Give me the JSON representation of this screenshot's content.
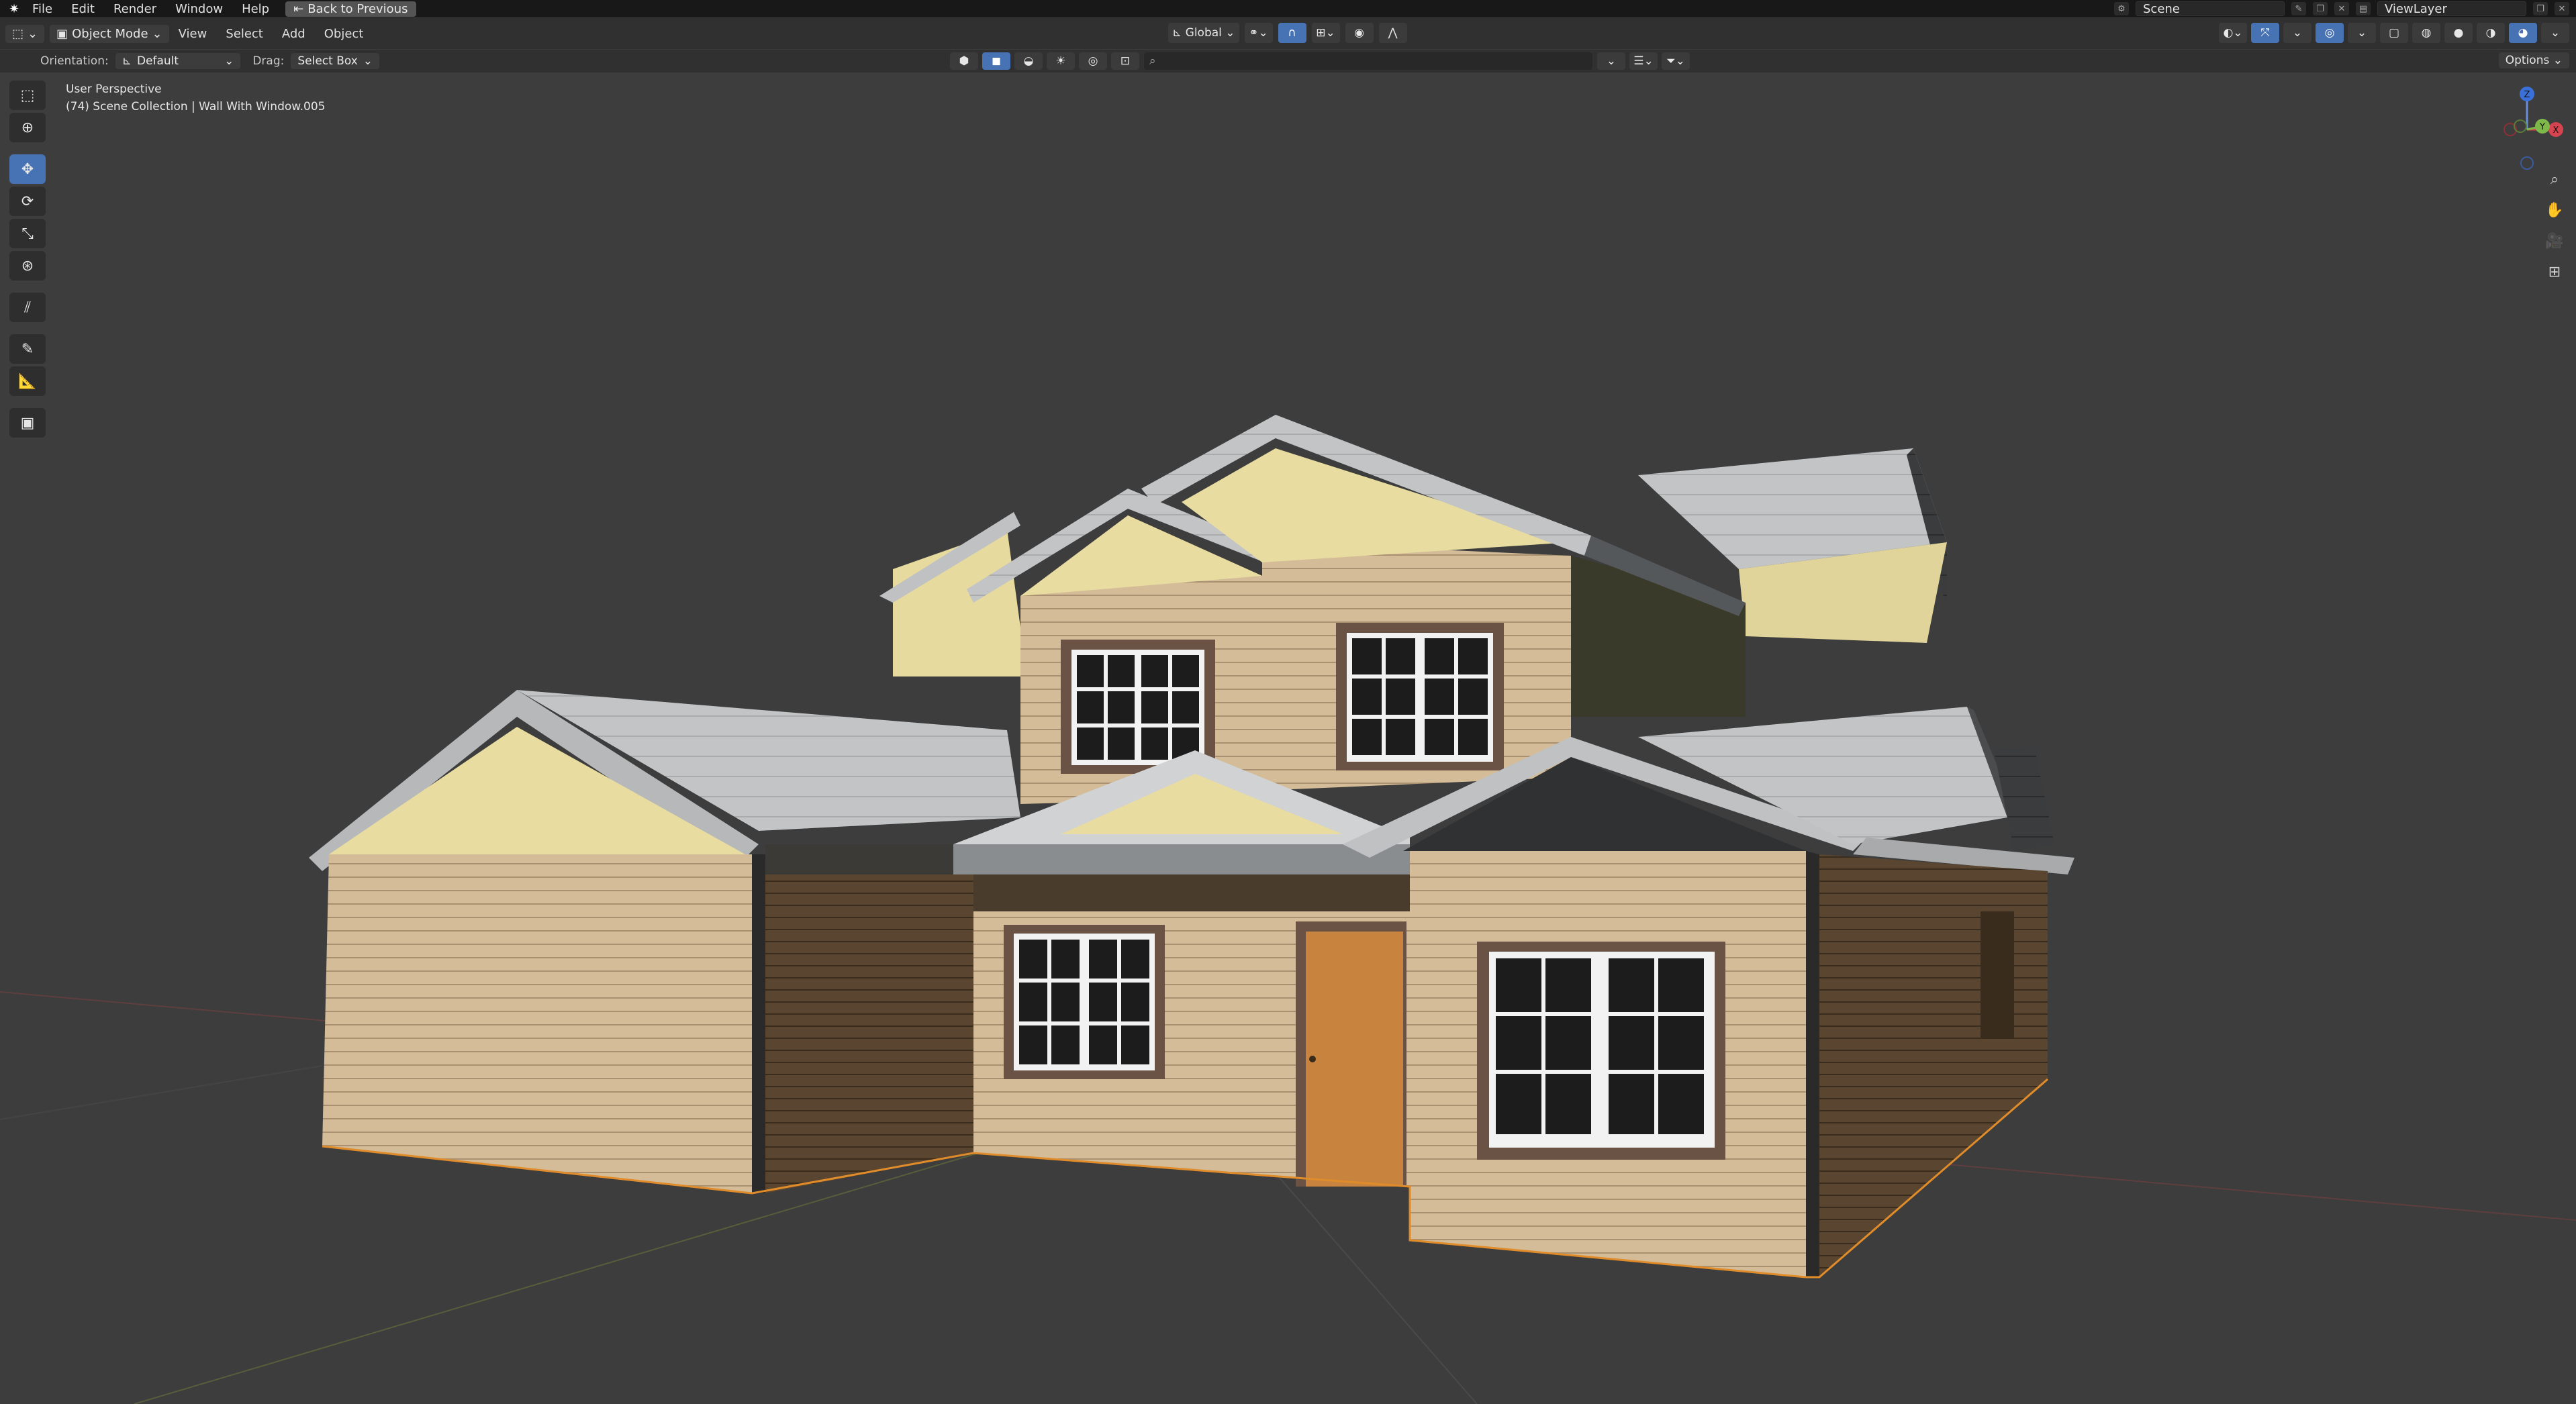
{
  "topbar": {
    "menus": [
      "File",
      "Edit",
      "Render",
      "Window",
      "Help"
    ],
    "back_button": "Back to Previous",
    "scene": "Scene",
    "view_layer": "ViewLayer"
  },
  "header": {
    "mode": "Object Mode",
    "menus": [
      "View",
      "Select",
      "Add",
      "Object"
    ],
    "transform_orientation": "Global"
  },
  "tool_settings": {
    "orientation_label": "Orientation:",
    "orientation_value": "Default",
    "drag_label": "Drag:",
    "drag_value": "Select Box",
    "options": "Options"
  },
  "viewport": {
    "view_name": "User Perspective",
    "collection": "(74) Scene Collection | Wall With Window.005"
  },
  "gizmo": {
    "z_label": "Z",
    "y_label": "Y",
    "x_label": "X"
  },
  "colors": {
    "accent": "#4772b3",
    "siding": "#d4bc98",
    "siding_shadow": "#5a4630",
    "gable": "#e8dca0",
    "roof": "#c2c4c6",
    "door": "#c8843e"
  },
  "icons": {
    "blender": "blender-logo-icon",
    "move": "move-icon",
    "rotate": "rotate-icon",
    "scale": "scale-icon"
  }
}
